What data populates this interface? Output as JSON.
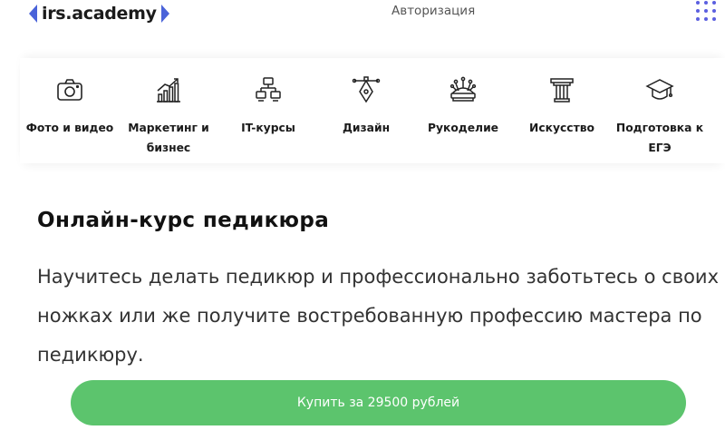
{
  "header": {
    "logo_text": "irs.academy",
    "auth_label": "Авторизация",
    "menu_icon": "grid-menu-icon",
    "brand_color": "#4a63d9"
  },
  "categories": [
    {
      "label": "Фото и видео",
      "icon": "camera-icon"
    },
    {
      "label": "Маркетинг и бизнес",
      "icon": "growth-chart-icon"
    },
    {
      "label": "IT-курсы",
      "icon": "network-icon"
    },
    {
      "label": "Дизайн",
      "icon": "pen-tool-icon"
    },
    {
      "label": "Рукоделие",
      "icon": "pincushion-icon"
    },
    {
      "label": "Искусство",
      "icon": "column-icon"
    },
    {
      "label": "Подготовка к ЕГЭ",
      "icon": "graduation-cap-icon"
    }
  ],
  "course": {
    "title": "Онлайн-курс педикюра",
    "description": "Научитесь делать педикюр и профессионально заботьтесь о своих ножках или же получите востребованную профессию мастера по педикюру."
  },
  "cta": {
    "label": "Купить за 29500 рублей",
    "color": "#5cc46d"
  }
}
